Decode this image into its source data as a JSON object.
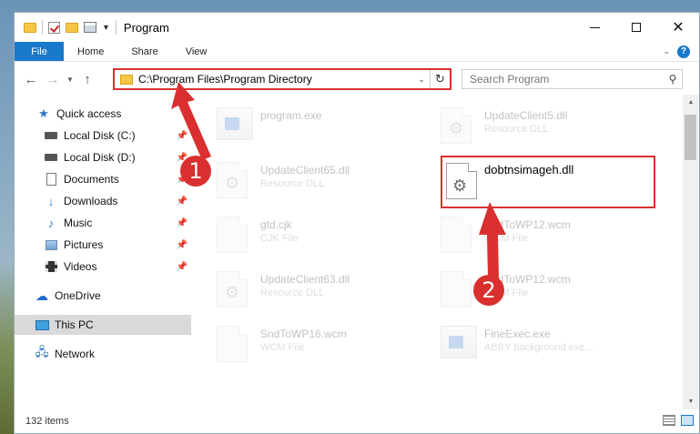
{
  "window": {
    "title": "Program"
  },
  "ribbon": {
    "tabs": [
      "File",
      "Home",
      "Share",
      "View"
    ]
  },
  "navbar": {
    "address": "C:\\Program Files\\Program Directory",
    "search_placeholder": "Search Program"
  },
  "sidebar": {
    "items": [
      {
        "label": "Quick access",
        "icon": "star-icon",
        "pinned": false
      },
      {
        "label": "Local Disk (C:)",
        "icon": "drive-icon",
        "pinned": true
      },
      {
        "label": "Local Disk (D:)",
        "icon": "drive-icon",
        "pinned": true
      },
      {
        "label": "Documents",
        "icon": "documents-icon",
        "pinned": true
      },
      {
        "label": "Downloads",
        "icon": "downloads-icon",
        "pinned": true
      },
      {
        "label": "Music",
        "icon": "music-icon",
        "pinned": true
      },
      {
        "label": "Pictures",
        "icon": "pictures-icon",
        "pinned": true
      },
      {
        "label": "Videos",
        "icon": "videos-icon",
        "pinned": true
      },
      {
        "label": "OneDrive",
        "icon": "cloud-icon",
        "pinned": false
      },
      {
        "label": "This PC",
        "icon": "computer-icon",
        "pinned": false,
        "selected": true
      },
      {
        "label": "Network",
        "icon": "network-icon",
        "pinned": false
      }
    ]
  },
  "files": [
    {
      "name": "program.exe",
      "type": ""
    },
    {
      "name": "UpdateClient5.dll",
      "type": "Resource DLL"
    },
    {
      "name": "UpdateClient65.dll",
      "type": "Resource DLL"
    },
    {
      "name": "dobtnsimageh.dll",
      "type": "",
      "highlighted": true
    },
    {
      "name": "gtd.cjk",
      "type": "CJK File"
    },
    {
      "name": "SndToWP12.wcm",
      "type": "WCM File"
    },
    {
      "name": "UpdateClient63.dll",
      "type": "Resource DLL"
    },
    {
      "name": "SndToWP12.wcm",
      "type": "WCM File"
    },
    {
      "name": "SndToWP16.wcm",
      "type": "WCM File"
    },
    {
      "name": "FineExec.exe",
      "type": "ABBY background exe..."
    }
  ],
  "status": {
    "item_count": "132 items"
  },
  "annotations": {
    "step1": "1",
    "step2": "2"
  },
  "colors": {
    "accent": "#1979ca",
    "annotation": "#d9302f"
  }
}
